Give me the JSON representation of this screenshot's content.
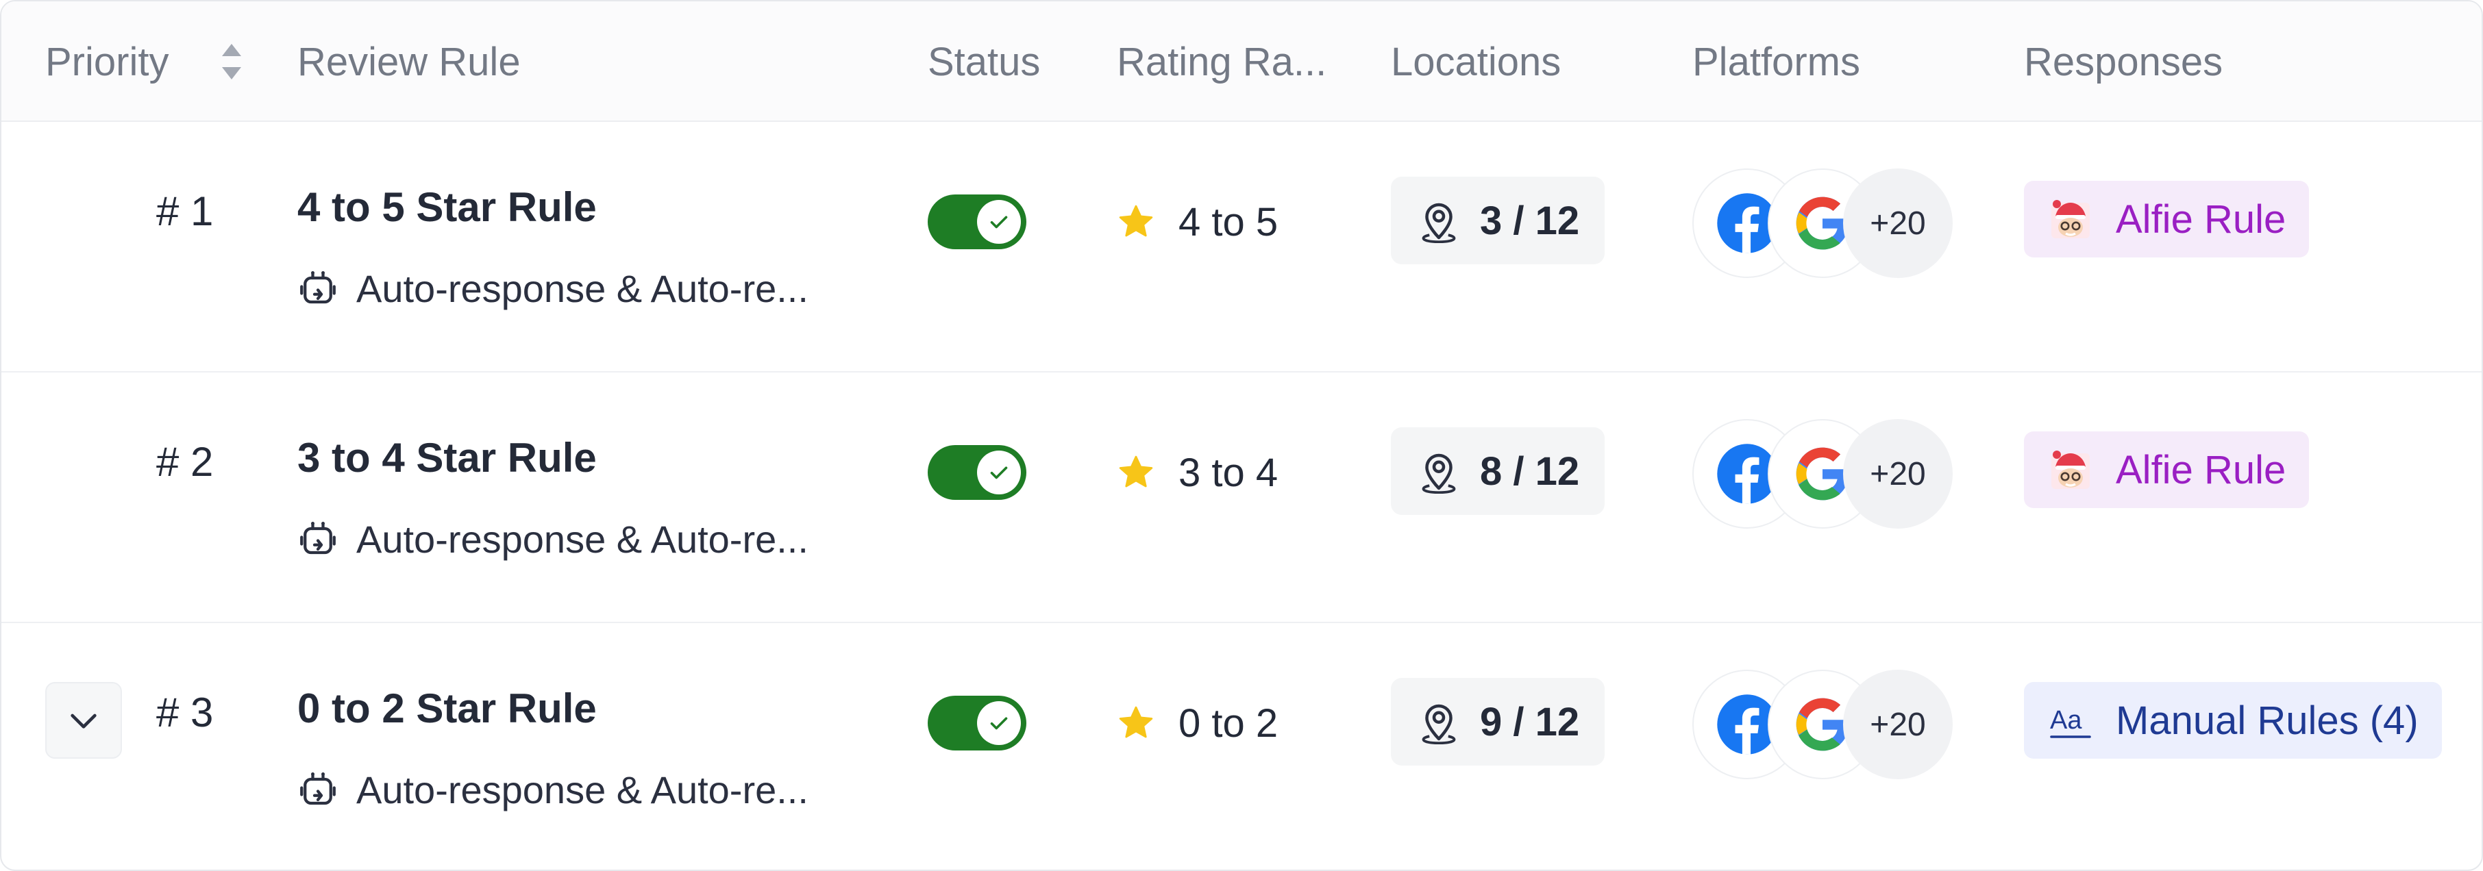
{
  "header": {
    "priority": "Priority",
    "review_rule": "Review Rule",
    "status": "Status",
    "rating_range": "Rating Ra...",
    "locations": "Locations",
    "platforms": "Platforms",
    "responses": "Responses"
  },
  "rows": [
    {
      "priority": "# 1",
      "name": "4 to 5 Star Rule",
      "subtitle": "Auto-response & Auto-re...",
      "status_enabled": true,
      "rating": "4 to 5",
      "locations": "3 / 12",
      "platform_icons": [
        "facebook-icon",
        "google-icon"
      ],
      "platforms_more": "+20",
      "response": "Alfie Rule",
      "response_type": "alfie"
    },
    {
      "priority": "# 2",
      "name": "3 to 4 Star Rule",
      "subtitle": "Auto-response & Auto-re...",
      "status_enabled": true,
      "rating": "3 to 4",
      "locations": "8 / 12",
      "platform_icons": [
        "facebook-icon",
        "google-icon"
      ],
      "platforms_more": "+20",
      "response": "Alfie Rule",
      "response_type": "alfie"
    },
    {
      "priority": "# 3",
      "name": "0 to 2 Star Rule",
      "subtitle": "Auto-response & Auto-re...",
      "status_enabled": true,
      "rating": "0 to 2",
      "locations": "9 / 12",
      "platform_icons": [
        "facebook-icon",
        "google-icon"
      ],
      "platforms_more": "+20",
      "response": "Manual Rules (4)",
      "response_type": "manual"
    }
  ],
  "colors": {
    "toggle_on": "#1e7d25",
    "star": "#f7c518",
    "alfie_text": "#9a1fc3",
    "alfie_bg": "#f5ebfa",
    "manual_text": "#1f3a93",
    "manual_bg": "#eceffd",
    "facebook": "#1877f2"
  }
}
